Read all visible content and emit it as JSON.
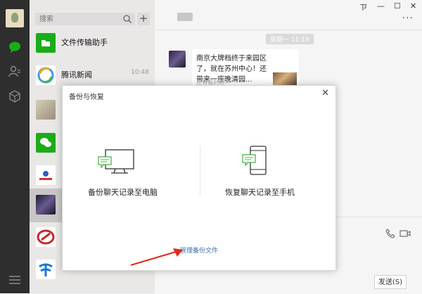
{
  "sidebar": {
    "search_placeholder": "搜索",
    "add_label": "+"
  },
  "chats": [
    {
      "name": "文件传输助手",
      "time": ""
    },
    {
      "name": "腾讯新闻",
      "time": "10:48"
    },
    {
      "name": "",
      "time": ""
    },
    {
      "name": "",
      "time": ""
    },
    {
      "name": "",
      "time": ""
    },
    {
      "name": "",
      "time": ""
    },
    {
      "name": "",
      "time": ""
    },
    {
      "name": "",
      "time": ""
    }
  ],
  "window": {
    "pin": "ㄗ",
    "minimize": "—",
    "maximize": "☐",
    "close": "✕",
    "more": "···"
  },
  "conversation": {
    "timestamp": "星期一 11:19",
    "card_text": "南京大牌档终于来园区了，就在苏州中心！还带来一座晚清园...",
    "card_sub": "还有福利哟~",
    "send_label": "发送(S)"
  },
  "dialog": {
    "title": "备份与恢复",
    "close": "✕",
    "backup_label": "备份聊天记录至电脑",
    "restore_label": "恢复聊天记录至手机",
    "manage_label": "管理备份文件"
  },
  "colors": {
    "nav_bg": "#2e2e2e",
    "accent_green": "#1aad19",
    "link_blue": "#3a6fb0",
    "arrow_red": "#e02a1f"
  }
}
